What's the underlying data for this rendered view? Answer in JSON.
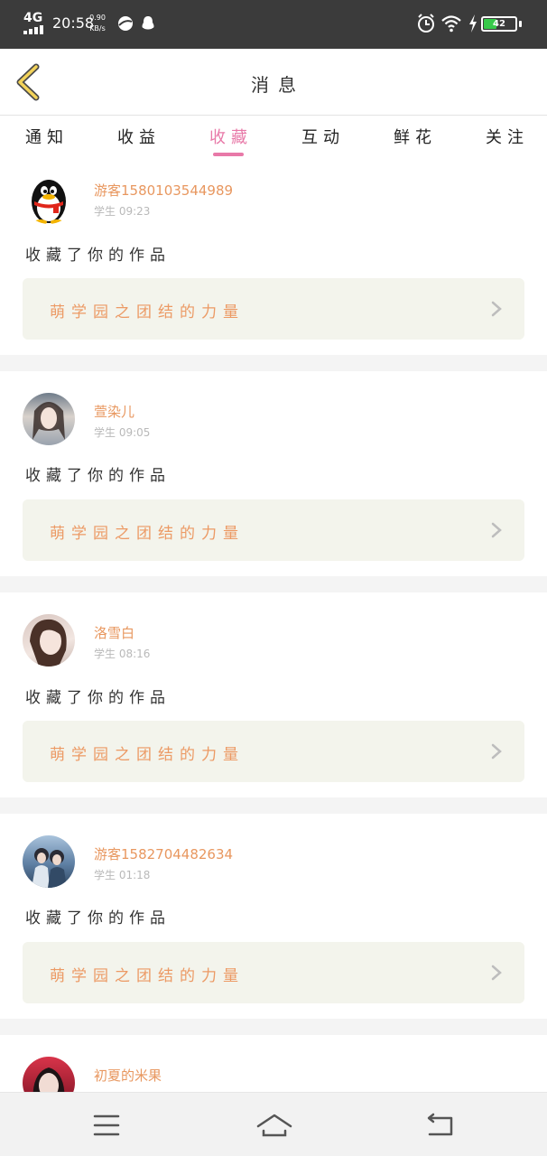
{
  "status_bar": {
    "network": "4G",
    "time": "20:58",
    "speed_value": "0.90",
    "speed_unit": "KB/s",
    "battery": "42",
    "battery_level": 0.42,
    "left_icons": [
      "browser-app-icon",
      "qq-notification-icon"
    ],
    "right_icons": [
      "alarm-icon",
      "wifi-icon",
      "charging-icon",
      "battery-icon"
    ]
  },
  "header": {
    "title": "消息",
    "back_icon": "chevron-left-icon"
  },
  "tabs": [
    {
      "label": "通知",
      "active": false
    },
    {
      "label": "收益",
      "active": false
    },
    {
      "label": "收藏",
      "active": true
    },
    {
      "label": "互动",
      "active": false
    },
    {
      "label": "鲜花",
      "active": false
    },
    {
      "label": "关注",
      "active": false
    }
  ],
  "feed": [
    {
      "user": "游客1580103544989",
      "meta": "学生 09:23",
      "avatar": "qq-penguin-avatar",
      "action": "收藏了你的作品",
      "work": "萌学园之团结的力量"
    },
    {
      "user": "萱染儿",
      "meta": "学生 09:05",
      "avatar": "girl-avatar",
      "action": "收藏了你的作品",
      "work": "萌学园之团结的力量"
    },
    {
      "user": "洛雪白",
      "meta": "学生 08:16",
      "avatar": "girl-avatar",
      "action": "收藏了你的作品",
      "work": "萌学园之团结的力量"
    },
    {
      "user": "游客1582704482634",
      "meta": "学生 01:18",
      "avatar": "couple-avatar",
      "action": "收藏了你的作品",
      "work": "萌学园之团结的力量"
    },
    {
      "user": "初夏的米果",
      "meta": "",
      "avatar": "girl-avatar",
      "action": "",
      "work": ""
    }
  ],
  "nav_bar": {
    "items": [
      "menu-icon",
      "home-icon",
      "back-icon"
    ]
  },
  "colors": {
    "accent": "#e879a8",
    "username": "#e8975f",
    "work_title": "#ec9a65",
    "card_bg": "#f3f4ec"
  }
}
